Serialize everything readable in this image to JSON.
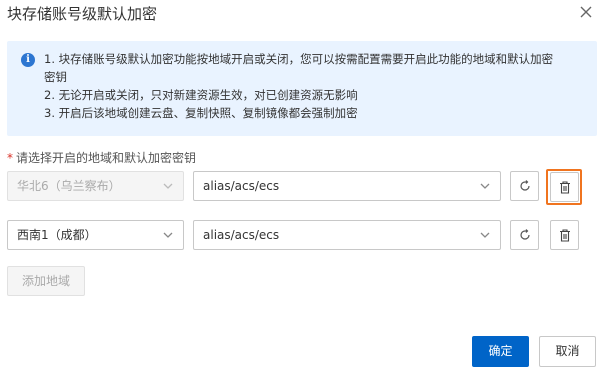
{
  "dialog": {
    "title": "块存储账号级默认加密",
    "close_icon": "close-icon"
  },
  "info": {
    "icon": "info-icon",
    "lines": [
      "1. 块存储账号级默认加密功能按地域开启或关闭，您可以按需配置需要开启此功能的地域和默认加密",
      "密钥",
      "2. 无论开启或关闭，只对新建资源生效，对已创建资源无影响",
      "3. 开启后该地域创建云盘、复制快照、复制镜像都会强制加密"
    ]
  },
  "form": {
    "required_mark": "*",
    "label": "请选择开启的地域和默认加密密钥",
    "rows": [
      {
        "region": "华北6（乌兰察布）",
        "region_disabled": true,
        "key": "alias/acs/ecs"
      },
      {
        "region": "西南1（成都）",
        "region_disabled": false,
        "key": "alias/acs/ecs"
      }
    ],
    "add_region_label": "添加地域"
  },
  "footer": {
    "ok_label": "确定",
    "cancel_label": "取消"
  },
  "colors": {
    "primary": "#0064c8",
    "info_bg": "#e9f3ff",
    "highlight": "#f0741f",
    "required": "#d93026"
  }
}
